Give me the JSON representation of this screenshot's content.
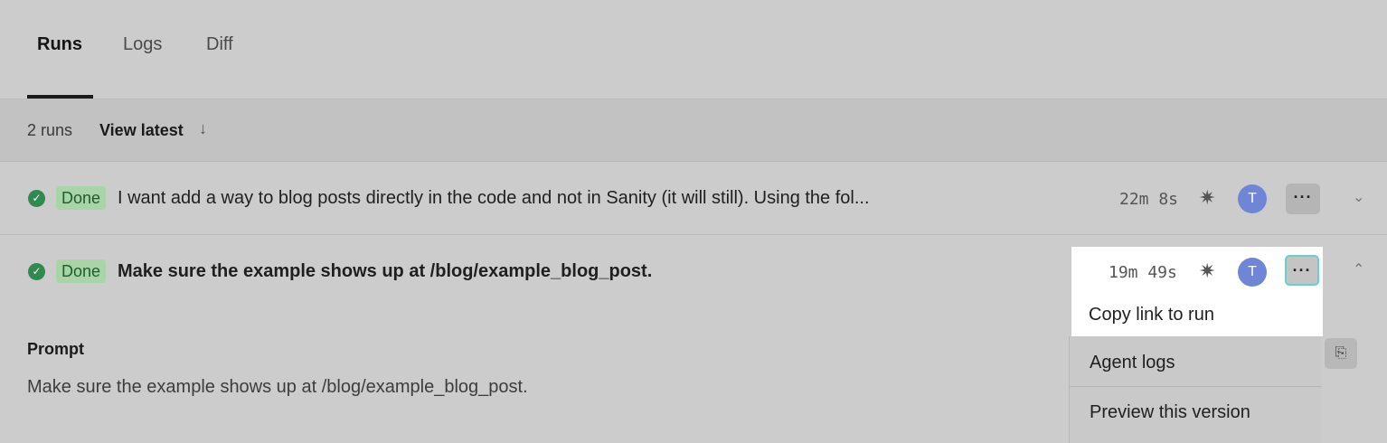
{
  "tabs": [
    {
      "label": "Runs",
      "active": true
    },
    {
      "label": "Logs",
      "active": false
    },
    {
      "label": "Diff",
      "active": false
    }
  ],
  "toolbar": {
    "runs_count": "2 runs",
    "view_latest": "View latest",
    "arrow_icon": "arrow-down-icon"
  },
  "runs": [
    {
      "status": "Done",
      "title": "I want add a way to blog posts directly in the code and not in Sanity (it will still). Using the fol...",
      "duration": "22m 8s",
      "avatar": "T",
      "more": "···"
    },
    {
      "status": "Done",
      "title": "Make sure the example shows up at /blog/example_blog_post.",
      "duration": "19m 49s",
      "avatar": "T",
      "more": "···"
    }
  ],
  "expanded": {
    "prompt_label": "Prompt",
    "prompt_text": "Make sure the example shows up at /blog/example_blog_post."
  },
  "menu": {
    "items": [
      "Copy link to run",
      "Agent logs",
      "Preview this version"
    ]
  },
  "colors": {
    "background": "#cccccc",
    "done_badge": "#a8d4a8",
    "check": "#2f8a4e",
    "avatar": "#6f86d6",
    "focus_ring": "#66d1cf"
  }
}
